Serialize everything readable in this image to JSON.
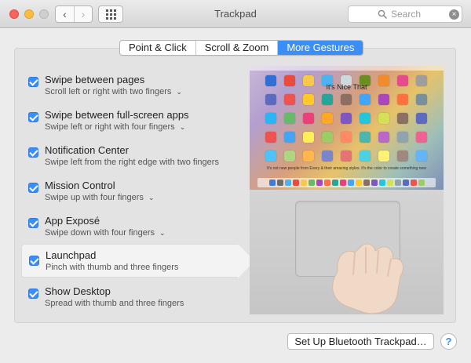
{
  "window": {
    "title": "Trackpad",
    "search_placeholder": "Search",
    "back_glyph": "‹",
    "forward_glyph": "›",
    "clear_glyph": "×"
  },
  "tabs": [
    {
      "label": "Point & Click",
      "active": false
    },
    {
      "label": "Scroll & Zoom",
      "active": false
    },
    {
      "label": "More Gestures",
      "active": true
    }
  ],
  "gestures": [
    {
      "title": "Swipe between pages",
      "subtitle": "Scroll left or right with two fingers",
      "checked": true,
      "has_dropdown": true
    },
    {
      "title": "Swipe between full-screen apps",
      "subtitle": "Swipe left or right with four fingers",
      "checked": true,
      "has_dropdown": true
    },
    {
      "title": "Notification Center",
      "subtitle": "Swipe left from the right edge with two fingers",
      "checked": true,
      "has_dropdown": false
    },
    {
      "title": "Mission Control",
      "subtitle": "Swipe up with four fingers",
      "checked": true,
      "has_dropdown": true
    },
    {
      "title": "App Exposé",
      "subtitle": "Swipe down with four fingers",
      "checked": true,
      "has_dropdown": true
    },
    {
      "title": "Launchpad",
      "subtitle": "Pinch with thumb and three fingers",
      "checked": true,
      "has_dropdown": false,
      "selected": true
    },
    {
      "title": "Show Desktop",
      "subtitle": "Spread with thumb and three fingers",
      "checked": true,
      "has_dropdown": false
    }
  ],
  "preview": {
    "screen_title": "It's Nice That",
    "caption": "It's not new people from Every & their amazing styles. It's the color to create something new"
  },
  "buttons": {
    "setup_bluetooth": "Set Up Bluetooth Trackpad…",
    "help": "?"
  },
  "colors": {
    "accent": "#3a8ef7",
    "close": "#fc615d",
    "minimize": "#fdbc40",
    "maximize": "#cfcfcf"
  },
  "icons": {
    "dropdown": "chevron-down-icon",
    "search": "search-icon",
    "clear": "clear-icon",
    "grid": "show-all-grid-icon"
  }
}
